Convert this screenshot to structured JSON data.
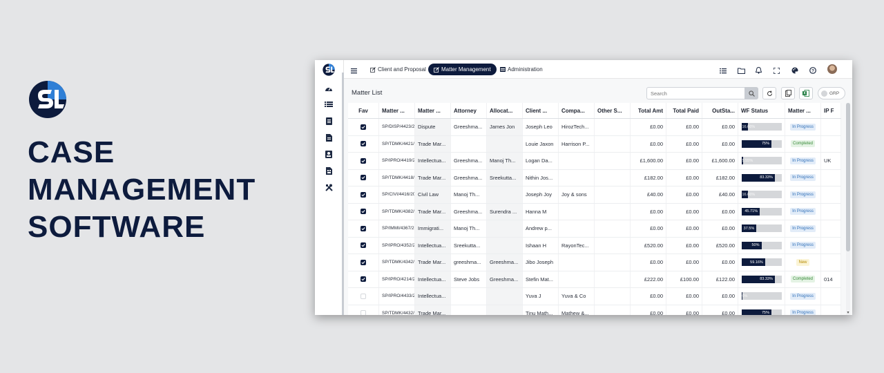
{
  "brand": {
    "headline": [
      "CASE",
      "MANAGEMENT",
      "SOFTWARE"
    ],
    "colors": {
      "navy": "#0d1b3d",
      "accent": "#2f7fd6"
    }
  },
  "sidebar": {
    "icons": [
      "dashboard-icon",
      "list-icon",
      "document-icon",
      "file-icon",
      "contact-card-icon",
      "report-icon",
      "tools-icon"
    ]
  },
  "topnav": {
    "tabs": [
      {
        "label": "Client and Proposal",
        "icon": "edit-icon"
      },
      {
        "label": "Matter Management",
        "icon": "edit-icon",
        "active": true
      },
      {
        "label": "Administration",
        "icon": "table-icon"
      }
    ],
    "right_icons": [
      "list-icon",
      "folder-icon",
      "bell-icon",
      "fullscreen-icon",
      "palette-icon",
      "help-icon",
      "avatar"
    ]
  },
  "matter_list": {
    "title": "Matter List",
    "search_placeholder": "Search",
    "grp_label": "GRP",
    "columns": [
      "Fav",
      "Matter ...",
      "Matter ...",
      "Attorney",
      "Allocat...",
      "Client ...",
      "Compa...",
      "Other S...",
      "Total Amt",
      "Total Paid",
      "OutSta...",
      "WF Status",
      "Matter ...",
      "IP F"
    ],
    "rows": [
      {
        "fav": true,
        "ref": "SP/DISP/4423/2",
        "type": "Dispute",
        "attorney": "Greeshma...",
        "alloc": "James Jon",
        "client": "Joseph Leo",
        "company": "HirozTech...",
        "other": "",
        "total": "£0.00",
        "paid": "£0.00",
        "out": "£0.00",
        "wf": 16.66,
        "wf_label": "16.66%",
        "status": "In Progress",
        "ip": ""
      },
      {
        "fav": true,
        "ref": "SP/TDMK/4421/",
        "type": "Trade Mar...",
        "attorney": "",
        "alloc": "",
        "client": "Louie Jaxon",
        "company": "Harrison P...",
        "other": "",
        "total": "£0.00",
        "paid": "£0.00",
        "out": "£0.00",
        "wf": 75,
        "wf_label": "75%",
        "status": "Completed",
        "ip": ""
      },
      {
        "fav": true,
        "ref": "SP/IPRO/4419/2",
        "type": "Intellectua...",
        "attorney": "Greeshma...",
        "alloc": "Manoj Th...",
        "client": "Logan Da...",
        "company": "",
        "other": "",
        "total": "£1,600.00",
        "paid": "£0.00",
        "out": "£1,600.00",
        "wf": 5,
        "wf_label": "5.55%",
        "status": "In Progress",
        "ip": "UK"
      },
      {
        "fav": true,
        "ref": "SP/TDMK/4418/",
        "type": "Trade Mar...",
        "attorney": "Greeshma...",
        "alloc": "Sreekutta...",
        "client": "Nithin Jos...",
        "company": "",
        "other": "",
        "total": "£182.00",
        "paid": "£0.00",
        "out": "£182.00",
        "wf": 83.33,
        "wf_label": "83.33%",
        "status": "In Progress",
        "ip": ""
      },
      {
        "fav": true,
        "ref": "SP/CIVI/4416/20",
        "type": "Civil Law",
        "attorney": "Manoj Th...",
        "alloc": "",
        "client": "Joseph Joy",
        "company": "Joy & sons",
        "other": "",
        "total": "£40.00",
        "paid": "£0.00",
        "out": "£40.00",
        "wf": 16.66,
        "wf_label": "16.66%",
        "status": "In Progress",
        "ip": ""
      },
      {
        "fav": true,
        "ref": "SP/TDMK/4382/",
        "type": "Trade Mar...",
        "attorney": "Greeshma...",
        "alloc": "Surendra ...",
        "client": "Hanna M",
        "company": "",
        "other": "",
        "total": "£0.00",
        "paid": "£0.00",
        "out": "£0.00",
        "wf": 45.71,
        "wf_label": "45.71%",
        "status": "In Progress",
        "ip": ""
      },
      {
        "fav": true,
        "ref": "SP/IMMI/4367/2",
        "type": "Immigrati...",
        "attorney": "Manoj Th...",
        "alloc": "",
        "client": "Andrew p...",
        "company": "",
        "other": "",
        "total": "£0.00",
        "paid": "£0.00",
        "out": "£0.00",
        "wf": 37.5,
        "wf_label": "37.5%",
        "status": "In Progress",
        "ip": ""
      },
      {
        "fav": true,
        "ref": "SP/IPRO/4352/2",
        "type": "Intellectua...",
        "attorney": "Sreekutta...",
        "alloc": "",
        "client": "Ishaan H",
        "company": "RayonTec...",
        "other": "",
        "total": "£520.00",
        "paid": "£0.00",
        "out": "£520.00",
        "wf": 50,
        "wf_label": "50%",
        "status": "In Progress",
        "ip": ""
      },
      {
        "fav": true,
        "ref": "SP/TDMK/4342/",
        "type": "Trade Mar...",
        "attorney": "greeshma...",
        "alloc": "Greeshma...",
        "client": "Jibo Joseph",
        "company": "",
        "other": "",
        "total": "£0.00",
        "paid": "£0.00",
        "out": "£0.00",
        "wf": 59.16,
        "wf_label": "59.16%",
        "status": "New",
        "ip": ""
      },
      {
        "fav": true,
        "ref": "SP/IPRO/4214/2",
        "type": "Intellectua...",
        "attorney": "Steve Jobs",
        "alloc": "Greeshma...",
        "client": "Stefin Mat...",
        "company": "",
        "other": "",
        "total": "£222.00",
        "paid": "£100.00",
        "out": "£122.00",
        "wf": 83.33,
        "wf_label": "83.33%",
        "status": "Completed",
        "ip": "014"
      },
      {
        "fav": false,
        "ref": "SP/IPRO/4433/2",
        "type": "Intellectua...",
        "attorney": "",
        "alloc": "",
        "client": "Yuva J",
        "company": "Yuva & Co",
        "other": "",
        "total": "£0.00",
        "paid": "£0.00",
        "out": "£0.00",
        "wf": 2,
        "wf_label": "0%",
        "status": "In Progress",
        "ip": ""
      },
      {
        "fav": false,
        "ref": "SP/TDMK/4432/",
        "type": "Trade Mar...",
        "attorney": "",
        "alloc": "",
        "client": "Tinu Math...",
        "company": "Mathew &...",
        "other": "",
        "total": "£0.00",
        "paid": "£0.00",
        "out": "£0.00",
        "wf": 75,
        "wf_label": "75%",
        "status": "In Progress",
        "ip": ""
      }
    ]
  }
}
